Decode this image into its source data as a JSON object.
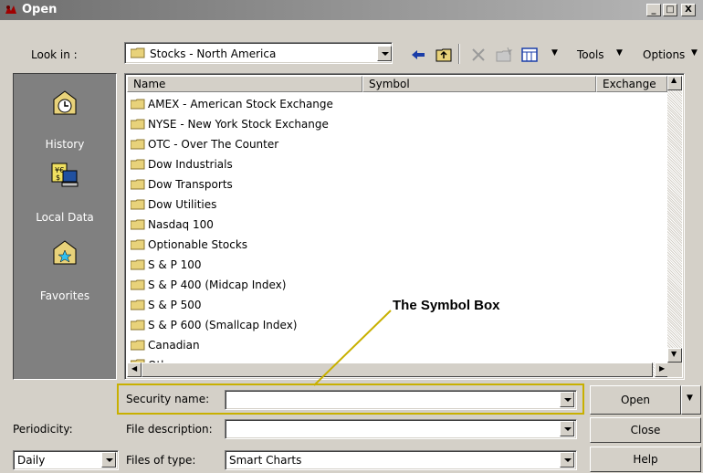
{
  "window": {
    "title": "Open",
    "minimize": "_",
    "maximize": "□",
    "close": "X"
  },
  "look_in": {
    "label": "Look in :",
    "value": "Stocks - North America"
  },
  "toolbar": {
    "tools": "Tools",
    "options": "Options"
  },
  "places": [
    {
      "label": "History",
      "icon": "history-icon"
    },
    {
      "label": "Local Data",
      "icon": "local-data-icon"
    },
    {
      "label": "Favorites",
      "icon": "favorites-icon"
    }
  ],
  "columns": {
    "name": "Name",
    "symbol": "Symbol",
    "exchange": "Exchange"
  },
  "files": [
    "AMEX - American Stock Exchange",
    "NYSE - New York Stock Exchange",
    "OTC - Over The Counter",
    "Dow Industrials",
    "Dow Transports",
    "Dow Utilities",
    "Nasdaq 100",
    "Optionable Stocks",
    "S & P 100",
    "S & P 400 (Midcap Index)",
    "S & P 500",
    "S & P 600 (Smallcap Index)",
    "Canadian",
    "Other"
  ],
  "annotation": "The Symbol Box",
  "security_name": {
    "label": "Security name:",
    "value": ""
  },
  "file_description": {
    "label": "File description:",
    "value": ""
  },
  "files_of_type": {
    "label": "Files of type:",
    "value": "Smart Charts"
  },
  "periodicity": {
    "label": "Periodicity:",
    "value": "Daily"
  },
  "buttons": {
    "open": "Open",
    "close": "Close",
    "help": "Help"
  },
  "colors": {
    "highlight": "#c8b000",
    "places_bg": "#808080",
    "dialog_bg": "#d4d0c8"
  }
}
